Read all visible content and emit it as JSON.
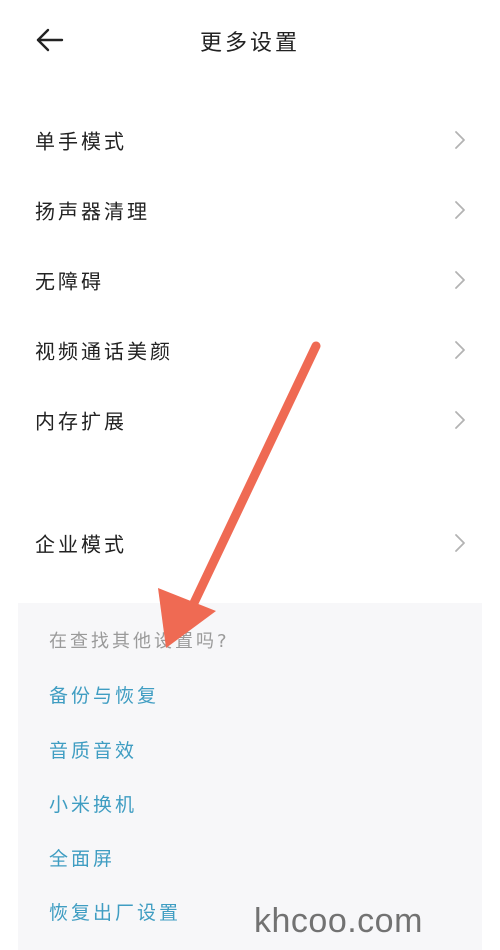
{
  "header": {
    "title": "更多设置",
    "back_icon": "arrow-left-icon"
  },
  "settings": {
    "items": [
      {
        "label": "单手模式"
      },
      {
        "label": "扬声器清理"
      },
      {
        "label": "无障碍"
      },
      {
        "label": "视频通话美颜"
      },
      {
        "label": "内存扩展"
      },
      {
        "label": "企业模式"
      }
    ],
    "chevron_icon": "chevron-right-icon"
  },
  "related": {
    "prompt": "在查找其他设置吗?",
    "links": [
      {
        "label": "备份与恢复"
      },
      {
        "label": "音质音效"
      },
      {
        "label": "小米换机"
      },
      {
        "label": "全面屏"
      },
      {
        "label": "恢复出厂设置"
      }
    ],
    "link_color": "#3f9dc2"
  },
  "annotation": {
    "arrow_color": "#ef6a53"
  },
  "watermark": {
    "text": "khcoo.com"
  }
}
